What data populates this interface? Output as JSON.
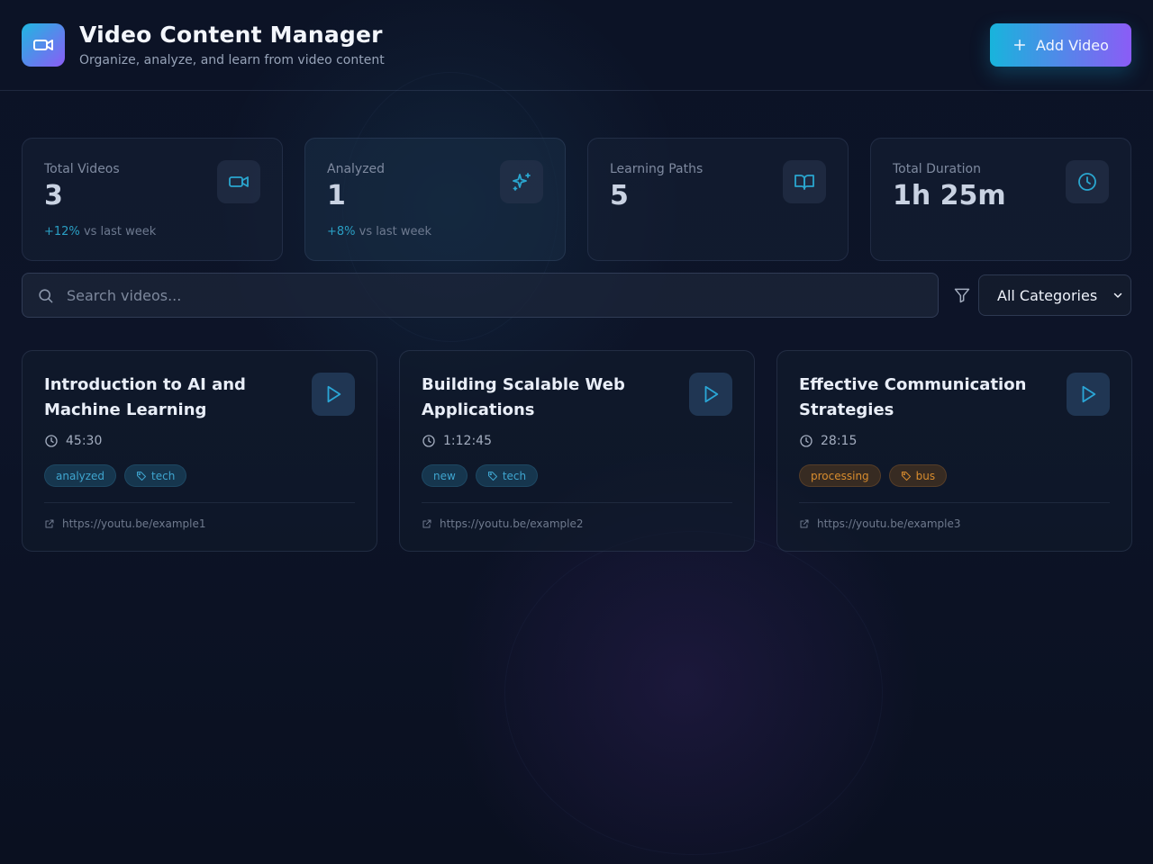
{
  "header": {
    "title": "Video Content Manager",
    "subtitle": "Organize, analyze, and learn from video content",
    "add_button_label": "Add Video"
  },
  "stats": [
    {
      "label": "Total Videos",
      "value": "3",
      "change": "+12%",
      "change_suffix": "vs last week",
      "icon": "video-icon"
    },
    {
      "label": "Analyzed",
      "value": "1",
      "change": "+8%",
      "change_suffix": "vs last week",
      "icon": "sparkles-icon"
    },
    {
      "label": "Learning Paths",
      "value": "5",
      "icon": "book-open-icon"
    },
    {
      "label": "Total Duration",
      "value": "1h 25m",
      "icon": "clock-icon"
    }
  ],
  "search": {
    "placeholder": "Search videos...",
    "category_selected": "All Categories"
  },
  "videos": [
    {
      "title": "Introduction to AI and Machine Learning",
      "duration": "45:30",
      "status": "analyzed",
      "category": "tech",
      "url": "https://youtu.be/example1"
    },
    {
      "title": "Building Scalable Web Applications",
      "duration": "1:12:45",
      "status": "new",
      "category": "tech",
      "url": "https://youtu.be/example2"
    },
    {
      "title": "Effective Communication Strategies",
      "duration": "28:15",
      "status": "processing",
      "category": "bus",
      "url": "https://youtu.be/example3"
    }
  ],
  "colors": {
    "accent_cyan": "#1fb7e0",
    "accent_purple": "#8b5cf6",
    "status_processing": "#d88c2e",
    "background": "#0b1122"
  }
}
